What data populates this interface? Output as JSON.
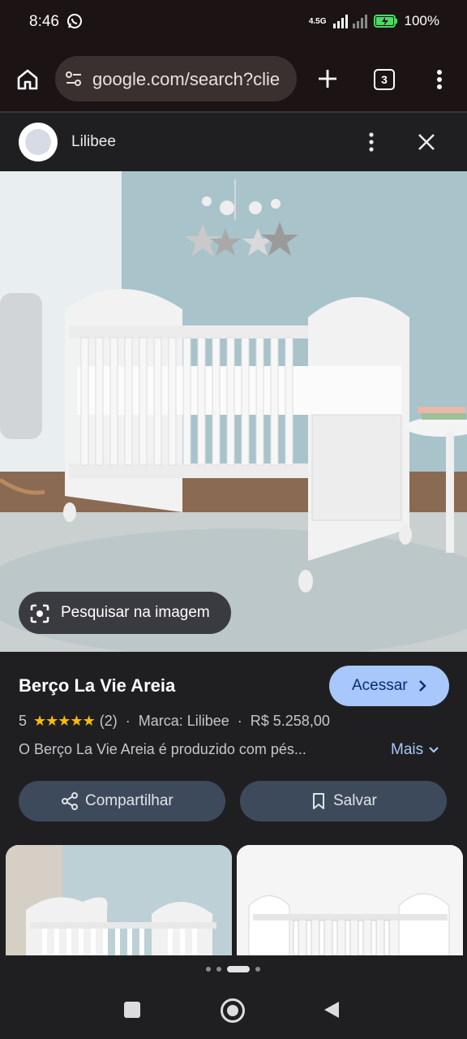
{
  "status_bar": {
    "time": "8:46",
    "network": "4.5G",
    "battery": "100%",
    "whatsapp_icon": "whatsapp-icon"
  },
  "browser": {
    "url": "google.com/search?clie",
    "tab_count": "3"
  },
  "source": {
    "name": "Lilibee"
  },
  "image": {
    "lens_label": "Pesquisar na imagem"
  },
  "product": {
    "title": "Berço La Vie Areia",
    "visit_label": "Acessar",
    "rating": "5",
    "stars": "★★★★★",
    "review_count": "(2)",
    "brand": "Marca: Lilibee",
    "price": "R$ 5.258,00",
    "description": "O Berço La Vie Areia é produzido com pés...",
    "more_label": "Mais",
    "share_label": "Compartilhar",
    "save_label": "Salvar"
  },
  "colors": {
    "accent": "#a8c7fa",
    "star": "#fbbc04",
    "button_bg": "#3c4a5c"
  }
}
